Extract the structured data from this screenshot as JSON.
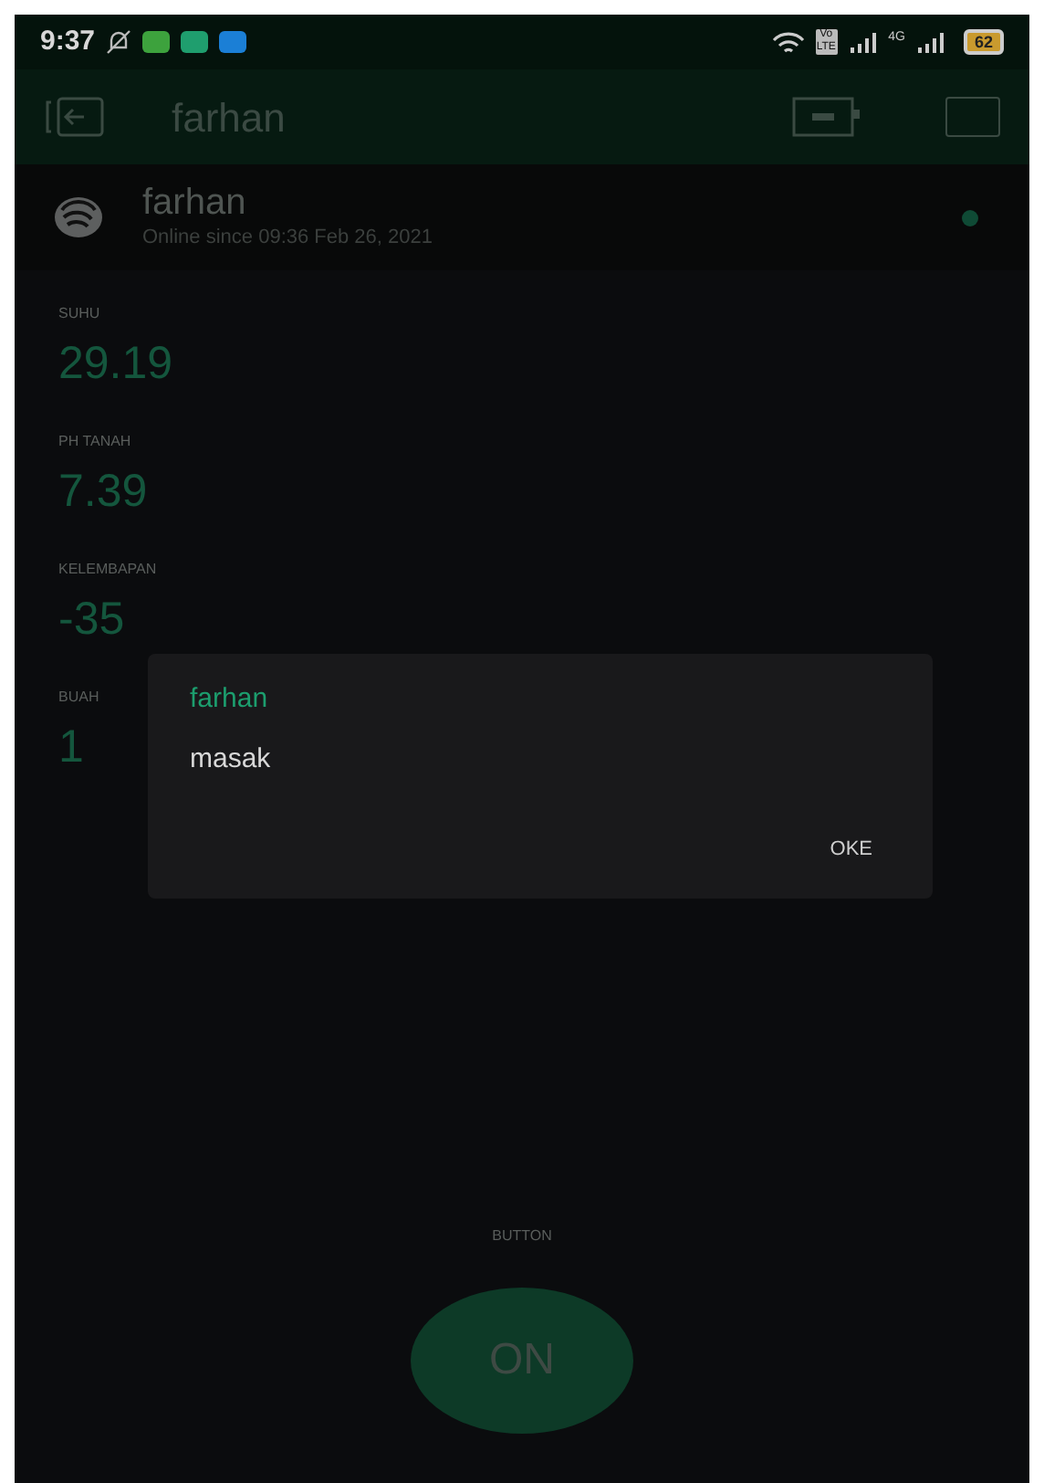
{
  "status_bar": {
    "time": "9:37",
    "battery": "62",
    "network": "4G",
    "volte": "Vo LTE"
  },
  "header": {
    "title": "farhan"
  },
  "device": {
    "name": "farhan",
    "status": "Online since 09:36 Feb 26, 2021",
    "online": true
  },
  "widgets": [
    {
      "label": "SUHU",
      "value": "29.19"
    },
    {
      "label": "PH TANAH",
      "value": "7.39"
    },
    {
      "label": "KELEMBAPAN",
      "value": "-35"
    },
    {
      "label": "BUAH",
      "value": "1"
    }
  ],
  "dialog": {
    "title": "farhan",
    "message": "masak",
    "button": "OKE"
  },
  "button_widget": {
    "label": "BUTTON",
    "text": "ON",
    "on": true
  }
}
